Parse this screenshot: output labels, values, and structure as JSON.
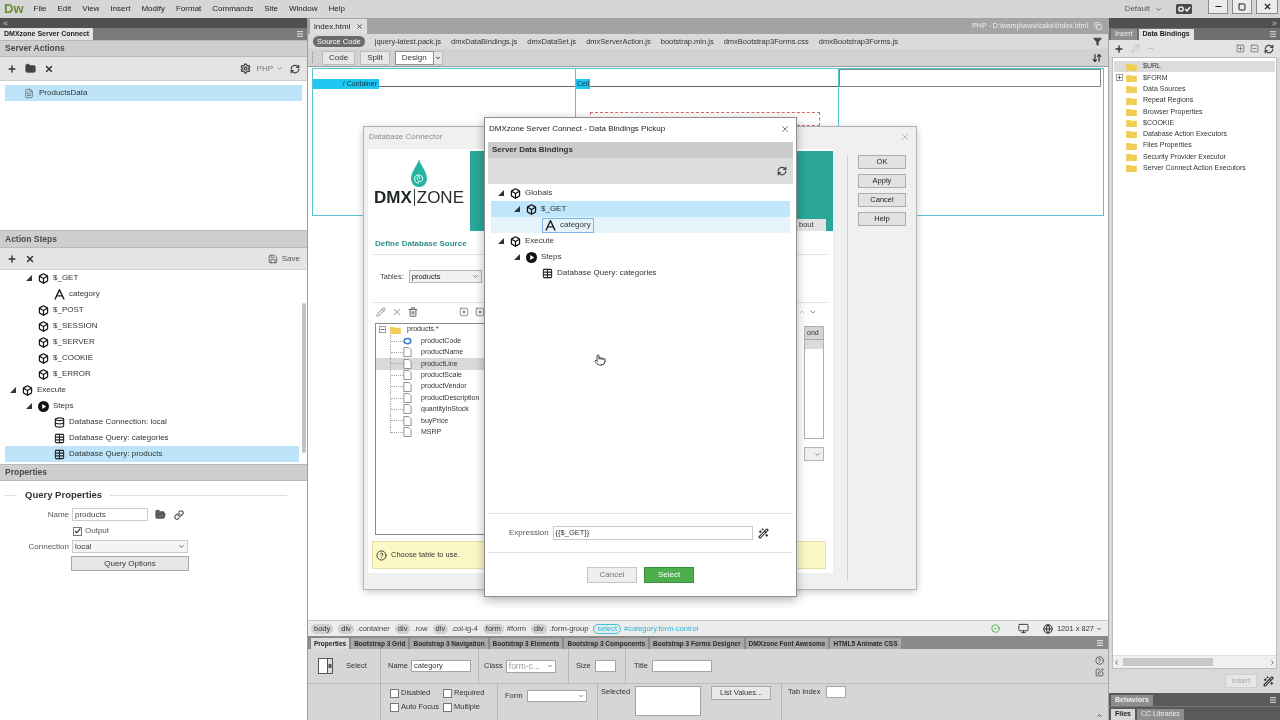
{
  "menu_bar": {
    "logo": "Dw",
    "items": [
      "File",
      "Edit",
      "View",
      "Insert",
      "Modify",
      "Format",
      "Commands",
      "Site",
      "Window",
      "Help"
    ],
    "workspace": "Default"
  },
  "left_panel": {
    "tab": "DMXzone Server Connect",
    "server_actions": {
      "title": "Server Actions",
      "language": "PHP",
      "items": [
        {
          "label": "ProductsData",
          "selected": true
        }
      ]
    },
    "action_steps": {
      "title": "Action Steps",
      "save": "Save",
      "tree": [
        {
          "children": [
            {
              "label": "$_GET",
              "kind": "object",
              "expanded": true,
              "selected": false,
              "children": [
                {
                  "label": "category",
                  "kind": "string",
                  "selected": false
                }
              ]
            },
            {
              "label": "$_POST",
              "kind": "object",
              "selected": false
            },
            {
              "label": "$_SESSION",
              "kind": "object",
              "selected": false
            },
            {
              "label": "$_SERVER",
              "kind": "object",
              "selected": false
            },
            {
              "label": "$_COOKIE",
              "kind": "object",
              "selected": false
            },
            {
              "label": "$_ERROR",
              "kind": "object",
              "selected": false
            }
          ]
        },
        {
          "label": "Execute",
          "kind": "object",
          "expanded": true,
          "selected": false,
          "children": [
            {
              "label": "Steps",
              "kind": "steps",
              "expanded": true,
              "selected": false,
              "children": [
                {
                  "label": "Database Connection: local",
                  "kind": "connection",
                  "selected": false
                },
                {
                  "label": "Database Query: categories",
                  "kind": "query",
                  "selected": false
                },
                {
                  "label": "Database Query: products",
                  "kind": "query",
                  "selected": true
                }
              ]
            }
          ]
        }
      ]
    },
    "properties": {
      "title": "Properties",
      "section": "Query Properties",
      "name": {
        "label": "Name",
        "value": "products"
      },
      "output": {
        "label": "Output",
        "checked": true
      },
      "connection": {
        "label": "Connection",
        "value": "local"
      },
      "query_options": "Query Options"
    }
  },
  "document": {
    "tab": "index.html",
    "path": "PHP - D:\\wamp\\www\\cake\\index.html",
    "related_files": [
      {
        "label": "Source Code",
        "selected": true
      },
      {
        "label": "jquery-latest.pack.js",
        "selected": false
      },
      {
        "label": "dmxDataBindings.js",
        "selected": false
      },
      {
        "label": "dmxDataSet.js",
        "selected": false
      },
      {
        "label": "dmxServerAction.js",
        "selected": false
      },
      {
        "label": "bootstrap.min.js",
        "selected": false
      },
      {
        "label": "dmxBootstrap3Forms.css",
        "selected": false
      },
      {
        "label": "dmxBootstrap3Forms.js",
        "selected": false
      }
    ],
    "view_modes": [
      {
        "label": "Code",
        "selected": false
      },
      {
        "label": "Split",
        "selected": false
      },
      {
        "label": "Design",
        "selected": true
      }
    ],
    "design_view": {
      "container_label": "/ Container",
      "cell_label": "Cell"
    },
    "database_connector": {
      "title": "Database Connector",
      "logo": {
        "left": "DMX",
        "right": "ZONE"
      },
      "banner_button": "bout",
      "heading": "Define Database Source",
      "tables": {
        "label": "Tables:",
        "value": "products"
      },
      "tree": [
        {
          "label": "products.*",
          "kind": "table",
          "expanded": true,
          "selected": false,
          "children": [
            {
              "label": "productCode",
              "kind": "key",
              "selected": false
            },
            {
              "label": "productName",
              "kind": "field",
              "selected": false
            },
            {
              "label": "productLine",
              "kind": "field",
              "selected": true
            },
            {
              "label": "productScale",
              "kind": "field",
              "selected": false
            },
            {
              "label": "productVendor",
              "kind": "field",
              "selected": false
            },
            {
              "label": "productDescription",
              "kind": "field",
              "selected": false
            },
            {
              "label": "quantityInStock",
              "kind": "field",
              "selected": false
            },
            {
              "label": "buyPrice",
              "kind": "field",
              "selected": false
            },
            {
              "label": "MSRP",
              "kind": "field",
              "selected": false
            }
          ]
        }
      ],
      "column_header": "ond",
      "hint": "Choose table to use.",
      "buttons": [
        "OK",
        "Apply",
        "Cancel",
        "Help"
      ]
    },
    "bindings_pickup": {
      "title": "DMXzone Server Connect - Data Bindings Pickup",
      "header": "Server Data Bindings",
      "tree": [
        {
          "label": "Globals",
          "kind": "object",
          "expanded": true,
          "selected": false,
          "focused": false,
          "children": [
            {
              "label": "$_GET",
              "kind": "object",
              "expanded": true,
              "selected": true,
              "focused": false,
              "children": [
                {
                  "label": "category",
                  "kind": "string",
                  "selected": false,
                  "focused": true
                }
              ]
            }
          ]
        },
        {
          "label": "Execute",
          "kind": "object",
          "expanded": true,
          "selected": false,
          "focused": false,
          "children": [
            {
              "label": "Steps",
              "kind": "steps",
              "expanded": true,
              "selected": false,
              "focused": false,
              "children": [
                {
                  "label": "Database Query: categories",
                  "kind": "query",
                  "selected": false,
                  "focused": false
                }
              ]
            }
          ]
        }
      ],
      "expression": {
        "label": "Expression",
        "value": "{{$_GET}}"
      },
      "buttons": [
        {
          "label": "Cancel",
          "kind": "secondary"
        },
        {
          "label": "Select",
          "kind": "primary"
        }
      ]
    },
    "tag_selector": {
      "tags": [
        {
          "tag": "body",
          "selected": false
        },
        {
          "tag": "div",
          "selector": ".container",
          "selected": false
        },
        {
          "tag": "div",
          "selector": ".row",
          "selected": false
        },
        {
          "tag": "div",
          "selector": ".col-lg-4",
          "selected": false
        },
        {
          "tag": "form",
          "selector": "#form",
          "selected": false
        },
        {
          "tag": "div",
          "selector": ".form-group",
          "selected": false
        },
        {
          "tag": "select",
          "selector": "#category.form-control",
          "selected": true
        }
      ],
      "size": "1201 x 827"
    }
  },
  "properties_panel": {
    "tabs": [
      {
        "label": "Properties",
        "selected": true
      },
      {
        "label": "Bootstrap 3 Grid",
        "selected": false
      },
      {
        "label": "Bootstrap 3 Navigation",
        "selected": false
      },
      {
        "label": "Bootstrap 3 Elements",
        "selected": false
      },
      {
        "label": "Bootstrap 3 Components",
        "selected": false
      },
      {
        "label": "Bootstrap 3 Forms Designer",
        "selected": false
      },
      {
        "label": "DMXzone Font Awesome",
        "selected": false
      },
      {
        "label": "HTML5 Animate CSS",
        "selected": false
      }
    ],
    "element": "Select",
    "name": {
      "label": "Name",
      "value": "category"
    },
    "class": {
      "label": "Class",
      "value": "form-c..."
    },
    "size": {
      "label": "Size"
    },
    "title": {
      "label": "Title"
    },
    "checkboxes": [
      {
        "label": "Disabled",
        "checked": false
      },
      {
        "label": "Required",
        "checked": false
      },
      {
        "label": "Auto Focus",
        "checked": false
      },
      {
        "label": "Multiple",
        "checked": false
      }
    ],
    "form": {
      "label": "Form"
    },
    "selected_values": {
      "label": "Selected"
    },
    "list_values": "List Values...",
    "tab_index": {
      "label": "Tab Index"
    }
  },
  "right_panel": {
    "tabs": [
      {
        "label": "Insert",
        "selected": false
      },
      {
        "label": "Data Bindings",
        "selected": true
      }
    ],
    "tree": [
      {
        "label": "$URL",
        "selected": true
      },
      {
        "label": "$FORM",
        "selected": false,
        "expanded": false
      },
      {
        "label": "Data Sources",
        "selected": false
      },
      {
        "label": "Repeat Regions",
        "selected": false
      },
      {
        "label": "Browser Properties",
        "selected": false
      },
      {
        "label": "$COOKIE",
        "selected": false
      },
      {
        "label": "Database Action Executors",
        "selected": false
      },
      {
        "label": "Files Properties",
        "selected": false
      },
      {
        "label": "Security Provider Executor",
        "selected": false
      },
      {
        "label": "Server Connect Action Executors",
        "selected": false
      }
    ],
    "insert_button": {
      "label": "Insert",
      "disabled": true
    },
    "behaviors": "Behaviors",
    "bottom_tabs": [
      {
        "label": "Files",
        "selected": true
      },
      {
        "label": "CC Libraries",
        "selected": false
      }
    ]
  }
}
